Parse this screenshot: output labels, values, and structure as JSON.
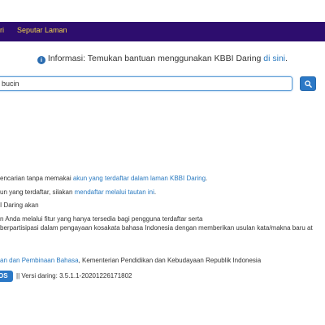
{
  "navbar": {
    "item1_label": "ri",
    "item2_label": "Seputar Laman"
  },
  "info": {
    "prefix": "Informasi: Temukan bantuan menggunakan KBBI Daring ",
    "link": "di sini",
    "suffix": "."
  },
  "search": {
    "value": "bucin"
  },
  "content": {
    "line1_prefix": "encarian tanpa memakai ",
    "line1_link": "akun yang terdaftar dalam laman KBBI Daring",
    "line1_suffix": ".",
    "line2_prefix": "un yang terdaftar, silakan ",
    "line2_link": "mendaftar melalui tautan ini",
    "line2_suffix": ".",
    "line3": "I Daring akan",
    "line4": "n Anda melalui fitur yang hanya tersedia bagi pengguna terdaftar serta",
    "line5": "berpartisipasi dalam pengayaan kosakata bahasa Indonesia dengan memberikan usulan kata/makna baru at"
  },
  "footer": {
    "org_link": "an dan Pembinaan Bahasa",
    "org_suffix": ", Kementerian Pendidikan dan Kebudayaan Republik Indonesia",
    "os_label": "OS",
    "version": "|| Versi daring: 3.5.1.1-20201226171802"
  },
  "colors": {
    "navbar_bg": "#2d0d6e",
    "nav_link": "#f0d34a",
    "link": "#2a7ac0",
    "button": "#2b78c6"
  },
  "icons": [
    "info-icon",
    "search-icon"
  ]
}
